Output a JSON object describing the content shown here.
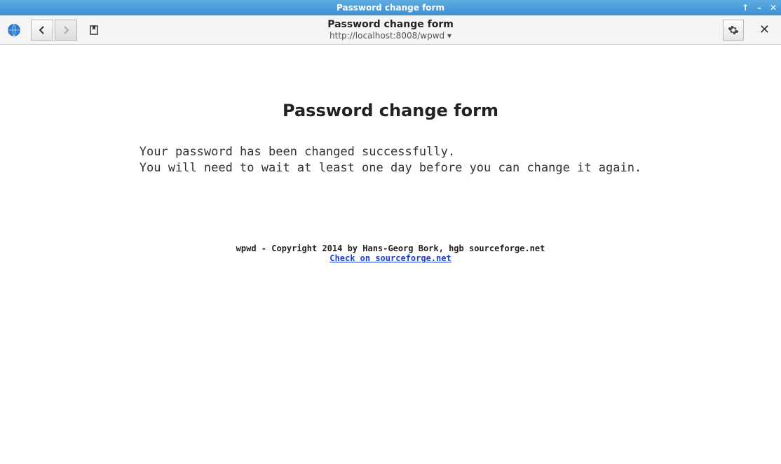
{
  "window": {
    "title": "Password change form"
  },
  "toolbar": {
    "page_title": "Password change form",
    "url": "http://localhost:8008/wpwd ▾"
  },
  "content": {
    "heading": "Password change form",
    "line1": "Your password has been changed successfully.",
    "line2": "You will need to wait at least one day before you can change it again."
  },
  "footer": {
    "copyright": "wpwd - Copyright 2014 by Hans-Georg Bork, hgb sourceforge.net",
    "link_text": "Check on sourceforge.net"
  }
}
